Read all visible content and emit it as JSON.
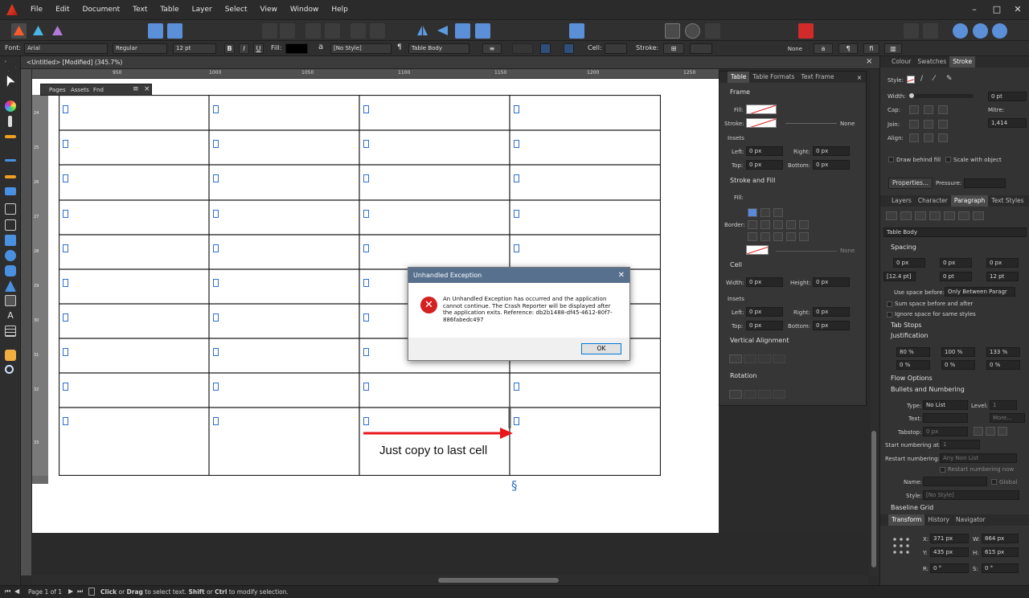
{
  "menu": [
    "File",
    "Edit",
    "Document",
    "Text",
    "Table",
    "Layer",
    "Select",
    "View",
    "Window",
    "Help"
  ],
  "context": {
    "font_label": "Font:",
    "font_value": "Arial",
    "style_value": "Regular",
    "size_value": "12 pt",
    "bold": "B",
    "italic": "I",
    "underline": "U",
    "fill_label": "Fill:",
    "char_style": "[No Style]",
    "para_style": "Table Body",
    "cell_label": "Cell:",
    "stroke_label": "Stroke:",
    "none_label": "None"
  },
  "document": {
    "tab_title": "<Untitled> [Modified] (345.7%)",
    "close": "×"
  },
  "ruler": {
    "h": [
      "950",
      "1000",
      "1050",
      "1100",
      "1150",
      "1200",
      "1250"
    ],
    "v": [
      "24",
      "25",
      "26",
      "27",
      "28",
      "29",
      "30",
      "31",
      "32",
      "33"
    ]
  },
  "floating_panel": {
    "tabs": [
      "Pages",
      "Assets",
      "Fnd"
    ]
  },
  "annotation": {
    "text": "Just copy to last cell",
    "section_mark": "§"
  },
  "table_panel": {
    "tabs": [
      "Table",
      "Table Formats",
      "Text Frame"
    ],
    "frame": "Frame",
    "fill": "Fill:",
    "stroke": "Stroke:",
    "none": "None",
    "insets": "Insets",
    "left": "Left:",
    "right": "Right:",
    "top": "Top:",
    "bottom": "Bottom:",
    "zero": "0 px",
    "stroke_and_fill": "Stroke and Fill",
    "border": "Border:",
    "cell": "Cell",
    "width": "Width:",
    "height": "Height:",
    "vertical_alignment": "Vertical Alignment",
    "rotation": "Rotation"
  },
  "stroke_panel": {
    "tabs": [
      "Colour",
      "Swatches",
      "Stroke"
    ],
    "style": "Style:",
    "width": "Width:",
    "width_val": "0 pt",
    "cap": "Cap:",
    "mitre": "Mitre:",
    "join": "Join:",
    "mitre_val": "1,414",
    "align": "Align:",
    "draw_behind": "Draw behind fill",
    "scale_with": "Scale with object",
    "properties": "Properties...",
    "pressure": "Pressure:"
  },
  "para_panel": {
    "tabs": [
      "Layers",
      "Character",
      "Paragraph",
      "Text Styles"
    ],
    "style": "Table Body",
    "spacing": "Spacing",
    "zero_px": "0 px",
    "zero_pt": "0 pt",
    "leading": "[12.4 pt]",
    "twelve": "12 pt",
    "use_space": "Use space before:",
    "use_space_val": "Only Between Paragr",
    "sum_space": "Sum space before and after",
    "ignore_space": "Ignore space for same styles",
    "tab_stops": "Tab Stops",
    "justification": "Justification",
    "j1": "80 %",
    "j2": "100 %",
    "j3": "133 %",
    "p0": "0 %",
    "flow": "Flow Options",
    "bullets": "Bullets and Numbering",
    "type": "Type:",
    "type_val": "No List",
    "level": "Level:",
    "level_val": "1",
    "text": "Text:",
    "more": "More...",
    "tabstop": "Tabstop:",
    "tabstop_val": "0 px",
    "start_at": "Start numbering at:",
    "start_val": "1",
    "restart": "Restart numbering:",
    "restart_val": "Any Non List",
    "restart_now": "Restart numbering now",
    "name": "Name:",
    "global": "Global",
    "style_lbl": "Style:",
    "style_none": "[No Style]",
    "baseline": "Baseline Grid"
  },
  "transform_panel": {
    "tabs": [
      "Transform",
      "History",
      "Navigator"
    ],
    "x": "X:",
    "x_val": "371 px",
    "w": "W:",
    "w_val": "864 px",
    "y": "Y:",
    "y_val": "435 px",
    "h": "H:",
    "h_val": "615 px",
    "r": "R:",
    "r_val": "0 °",
    "s": "S:",
    "s_val": "0 °"
  },
  "dialog": {
    "title": "Unhandled Exception",
    "close": "✕",
    "message": "An Unhandled Exception has occurred and the application cannot continue. The Crash Reporter will be displayed after the application exits. Reference: db2b1488-df45-4612-80f7-886fabedc497",
    "ok": "OK"
  },
  "status": {
    "page": "Page 1 of 1",
    "click": "Click",
    "or": " or ",
    "drag": "Drag",
    "rest1": " to select text. ",
    "shift": "Shift",
    "or2": " or ",
    "ctrl": "Ctrl",
    "rest2": " to modify selection."
  }
}
